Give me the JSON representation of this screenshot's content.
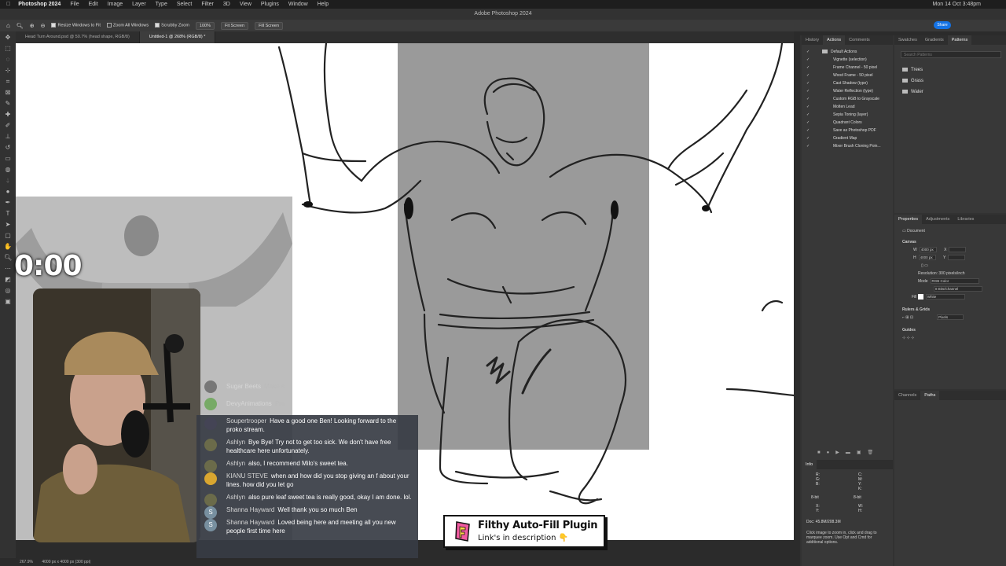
{
  "menubar": {
    "app": "Photoshop 2024",
    "items": [
      "File",
      "Edit",
      "Image",
      "Layer",
      "Type",
      "Select",
      "Filter",
      "3D",
      "View",
      "Plugins",
      "Window",
      "Help"
    ],
    "clock": "Mon 14 Oct 3:48pm"
  },
  "window_title": "Adobe Photoshop 2024",
  "options_bar": {
    "resize_windows": "Resize Windows to Fit",
    "zoom_all": "Zoom All Windows",
    "scrubby_zoom": "Scrubby Zoom",
    "zoom_value": "100%",
    "fit_screen": "Fit Screen",
    "fill_screen": "Fill Screen",
    "share": "Share"
  },
  "doc_tabs": [
    {
      "label": "Head Turn Around.psd @ 50.7% (head shape, RGB/8)"
    },
    {
      "label": "Untitled-1 @ 268% (RGB/8) *"
    }
  ],
  "statusbar": {
    "zoom": "267.9%",
    "docinfo": "4000 px x 4000 px (300 ppi)"
  },
  "actions_panel": {
    "tabs": [
      "History",
      "Actions",
      "Comments"
    ],
    "items": [
      "Default Actions",
      "Vignette (selection)",
      "Frame Channel - 50 pixel",
      "Wood Frame - 50 pixel",
      "Cast Shadow (type)",
      "Water Reflection (type)",
      "Custom RGB to Grayscale",
      "Molten Lead",
      "Sepia Toning (layer)",
      "Quadrant Colors",
      "Save as Photoshop PDF",
      "Gradient Map",
      "Mixer Brush Cloning Poin..."
    ]
  },
  "patterns_panel": {
    "tabs": [
      "Swatches",
      "Gradients",
      "Patterns"
    ],
    "search_placeholder": "Search Patterns",
    "folders": [
      "Trees",
      "Grass",
      "Water"
    ]
  },
  "properties_panel": {
    "tabs": [
      "Properties",
      "Adjustments",
      "Libraries"
    ],
    "doc_label": "Document",
    "canvas_title": "Canvas",
    "w_label": "W",
    "w_value": "4000 px",
    "h_label": "H",
    "h_value": "4000 px",
    "x_label": "X",
    "y_label": "Y",
    "resolution": "Resolution: 300 pixels/inch",
    "mode_label": "Mode",
    "mode_value": "RGB Color",
    "depth_value": "8 Bits/Channel",
    "fill_label": "Fill",
    "fill_value": "White",
    "rulers_title": "Rulers & Grids",
    "rulers_unit": "Pixels",
    "guides_title": "Guides"
  },
  "channels_panel": {
    "tabs": [
      "Channels",
      "Paths"
    ]
  },
  "info_panel": {
    "title": "Info",
    "rgb": [
      "R:",
      "G:",
      "B:"
    ],
    "cmyk": [
      "C:",
      "M:",
      "Y:",
      "K:"
    ],
    "bit_left": "8-bit",
    "bit_right": "8-bit",
    "xy": [
      "X:",
      "Y:"
    ],
    "wh": [
      "W:",
      "H:"
    ],
    "doc": "Doc: 45.8M/208.3M",
    "hint": "Click image to zoom in, click and drag to marquee zoom. Use Opt and Cmd for additional options."
  },
  "stream": {
    "timer": "0:00",
    "faded_chat": [
      {
        "name": "Sugar Beets",
        "text": "Make s"
      },
      {
        "name": "DevyAnimations",
        "text": "Pre"
      }
    ],
    "chat": [
      {
        "name": "Soupertrooper",
        "text": "Have a good one Ben! Looking forward to the proko stream.",
        "avatar": ""
      },
      {
        "name": "Ashlyn",
        "text": "Bye Bye! Try not to get too sick. We don't have free healthcare here unfortunately.",
        "avatar": ""
      },
      {
        "name": "Ashlyn",
        "text": "also, I recommend Milo's sweet tea.",
        "avatar": ""
      },
      {
        "name": "KIANU STEVE",
        "text": "when and how did you stop giving an f about your lines. how did you let go",
        "avatar": ""
      },
      {
        "name": "Ashlyn",
        "text": "also pure leaf sweet tea is really good, okay I am done. lol.",
        "avatar": ""
      },
      {
        "name": "Shanna Hayward",
        "text": "Well thank you so much Ben",
        "avatar": "S"
      },
      {
        "name": "Shanna Hayward",
        "text": "Loved being here and meeting all you new people first time here",
        "avatar": "S"
      }
    ],
    "plugin_title": "Filthy Auto-Fill Plugin",
    "plugin_sub": "Link's in description 👇"
  }
}
